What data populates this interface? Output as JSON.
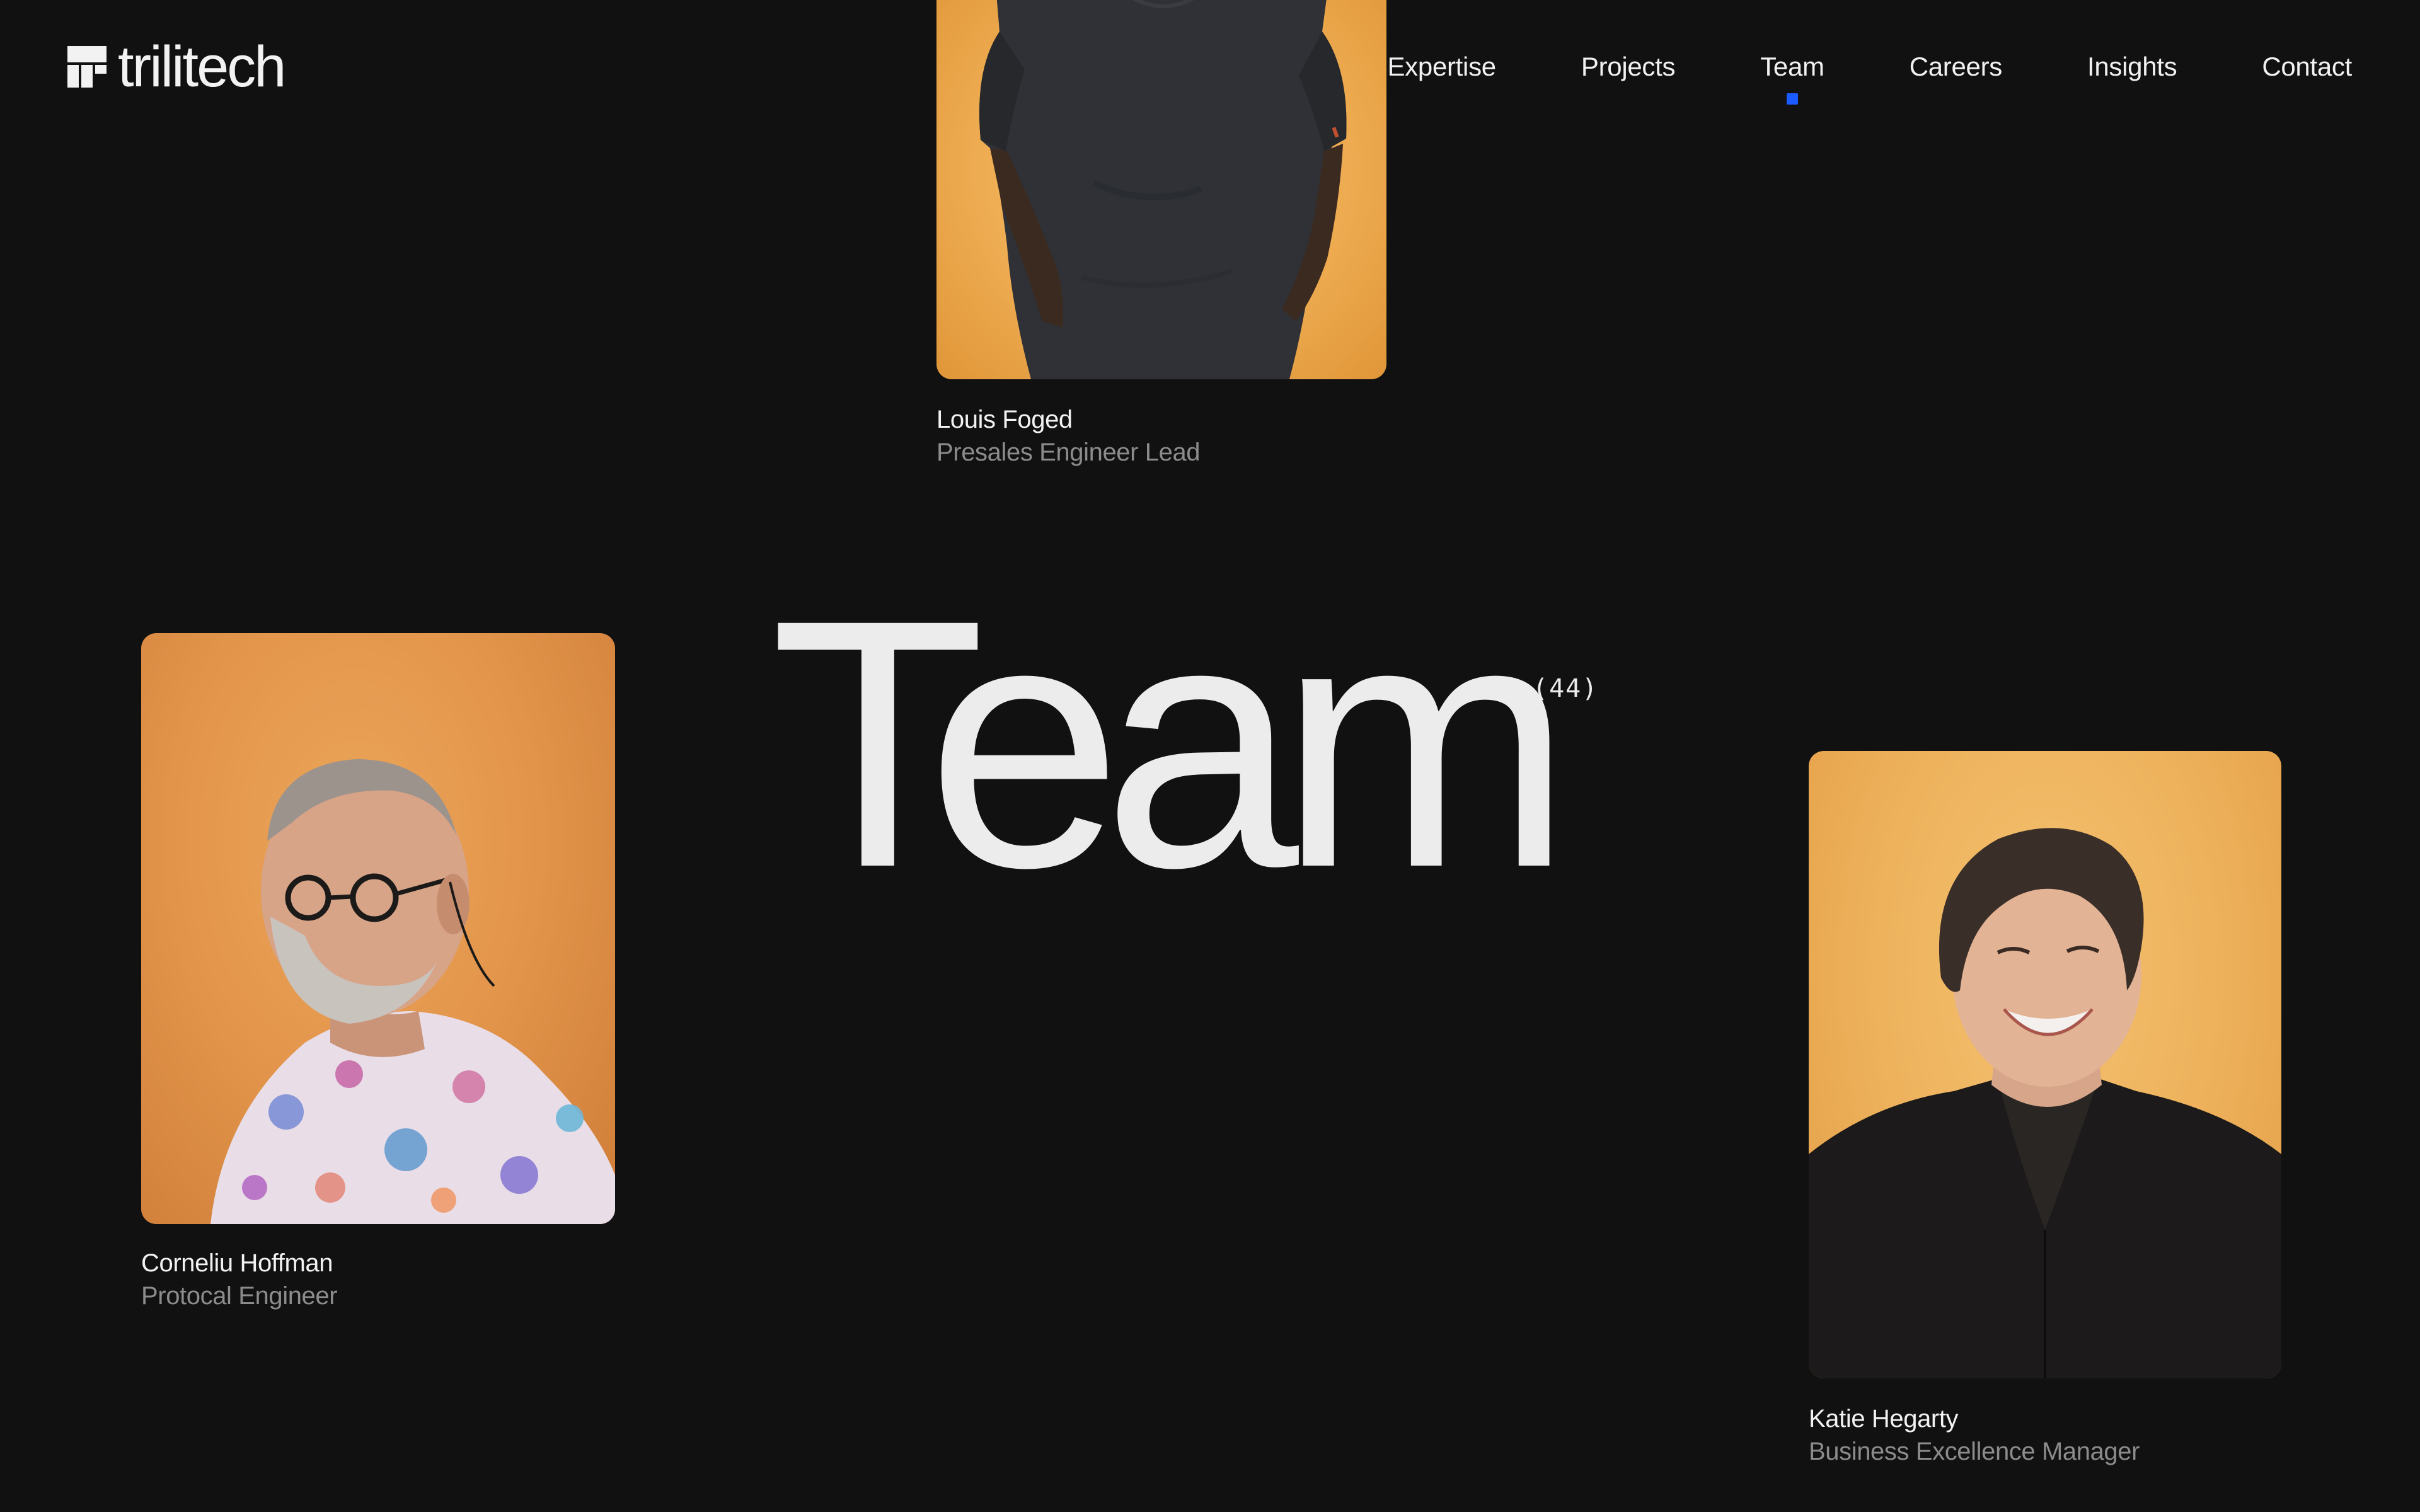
{
  "brand": {
    "name": "trilitech",
    "logo_icon": "trilitech-logo-icon"
  },
  "nav": {
    "items": [
      {
        "label": "Expertise",
        "active": false
      },
      {
        "label": "Projects",
        "active": false
      },
      {
        "label": "Team",
        "active": true
      },
      {
        "label": "Careers",
        "active": false
      },
      {
        "label": "Insights",
        "active": false
      },
      {
        "label": "Contact",
        "active": false
      }
    ],
    "active_indicator_color": "#1a5cff"
  },
  "hero": {
    "title": "Team",
    "count": "(44)"
  },
  "team": [
    {
      "name": "Louis Foged",
      "role": "Presales Engineer Lead"
    },
    {
      "name": "Corneliu Hoffman",
      "role": "Protocal Engineer"
    },
    {
      "name": "Katie Hegarty",
      "role": "Business Excellence Manager"
    }
  ],
  "colors": {
    "background": "#111111",
    "text_primary": "#f2f2f2",
    "text_secondary": "#8c8c8c",
    "accent": "#1a5cff",
    "photo_backdrop": "#efad53"
  }
}
